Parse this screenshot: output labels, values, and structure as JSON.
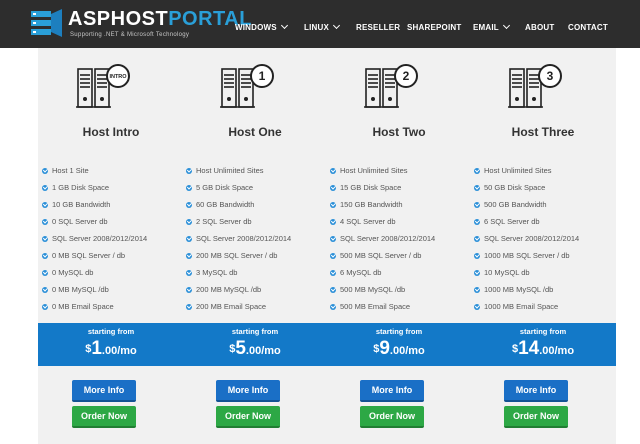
{
  "brand": {
    "name_part1": "ASPHOST",
    "name_part2": "PORTAL",
    "tagline": "Supporting .NET & Microsoft Technology",
    "primary_color": "#1379c8",
    "accent_color": "#2a9fd8",
    "order_color": "#2da845",
    "nav_bg": "#2d2d2d"
  },
  "nav": {
    "items": [
      {
        "label": "WINDOWS",
        "has_dropdown": true
      },
      {
        "label": "LINUX",
        "has_dropdown": true
      },
      {
        "label": "RESELLER",
        "has_dropdown": false
      },
      {
        "label": "SHAREPOINT",
        "has_dropdown": false
      },
      {
        "label": "EMAIL",
        "has_dropdown": true
      },
      {
        "label": "ABOUT",
        "has_dropdown": false
      },
      {
        "label": "CONTACT",
        "has_dropdown": false
      }
    ]
  },
  "plans": [
    {
      "title": "Host Intro",
      "badge": "INTRO",
      "features": [
        "Host 1 Site",
        "1 GB Disk Space",
        "10 GB Bandwidth",
        "0 SQL Server db",
        "SQL Server 2008/2012/2014",
        "0 MB SQL Server / db",
        "0 MySQL db",
        "0 MB MySQL /db",
        "0 MB Email Space"
      ],
      "starting_from": "starting from",
      "currency": "$",
      "price_int": "1",
      "price_rest": ".00/mo",
      "more_info": "More Info",
      "order_now": "Order Now"
    },
    {
      "title": "Host One",
      "badge": "1",
      "features": [
        "Host Unlimited Sites",
        "5 GB Disk Space",
        "60 GB Bandwidth",
        "2 SQL Server db",
        "SQL Server 2008/2012/2014",
        "200 MB SQL Server / db",
        "3 MySQL db",
        "200 MB MySQL /db",
        "200 MB Email Space"
      ],
      "starting_from": "starting from",
      "currency": "$",
      "price_int": "5",
      "price_rest": ".00/mo",
      "more_info": "More Info",
      "order_now": "Order Now"
    },
    {
      "title": "Host Two",
      "badge": "2",
      "features": [
        "Host Unlimited Sites",
        "15 GB Disk Space",
        "150 GB Bandwidth",
        "4 SQL Server db",
        "SQL Server 2008/2012/2014",
        "500 MB SQL Server / db",
        "6 MySQL db",
        "500 MB MySQL /db",
        "500 MB Email Space"
      ],
      "starting_from": "starting from",
      "currency": "$",
      "price_int": "9",
      "price_rest": ".00/mo",
      "more_info": "More Info",
      "order_now": "Order Now"
    },
    {
      "title": "Host Three",
      "badge": "3",
      "features": [
        "Host Unlimited Sites",
        "50 GB Disk Space",
        "500 GB Bandwidth",
        "6 SQL Server db",
        "SQL Server 2008/2012/2014",
        "1000 MB SQL Server / db",
        "10 MySQL db",
        "1000 MB MySQL /db",
        "1000 MB Email Space"
      ],
      "starting_from": "starting from",
      "currency": "$",
      "price_int": "14",
      "price_rest": ".00/mo",
      "more_info": "More Info",
      "order_now": "Order Now"
    }
  ]
}
